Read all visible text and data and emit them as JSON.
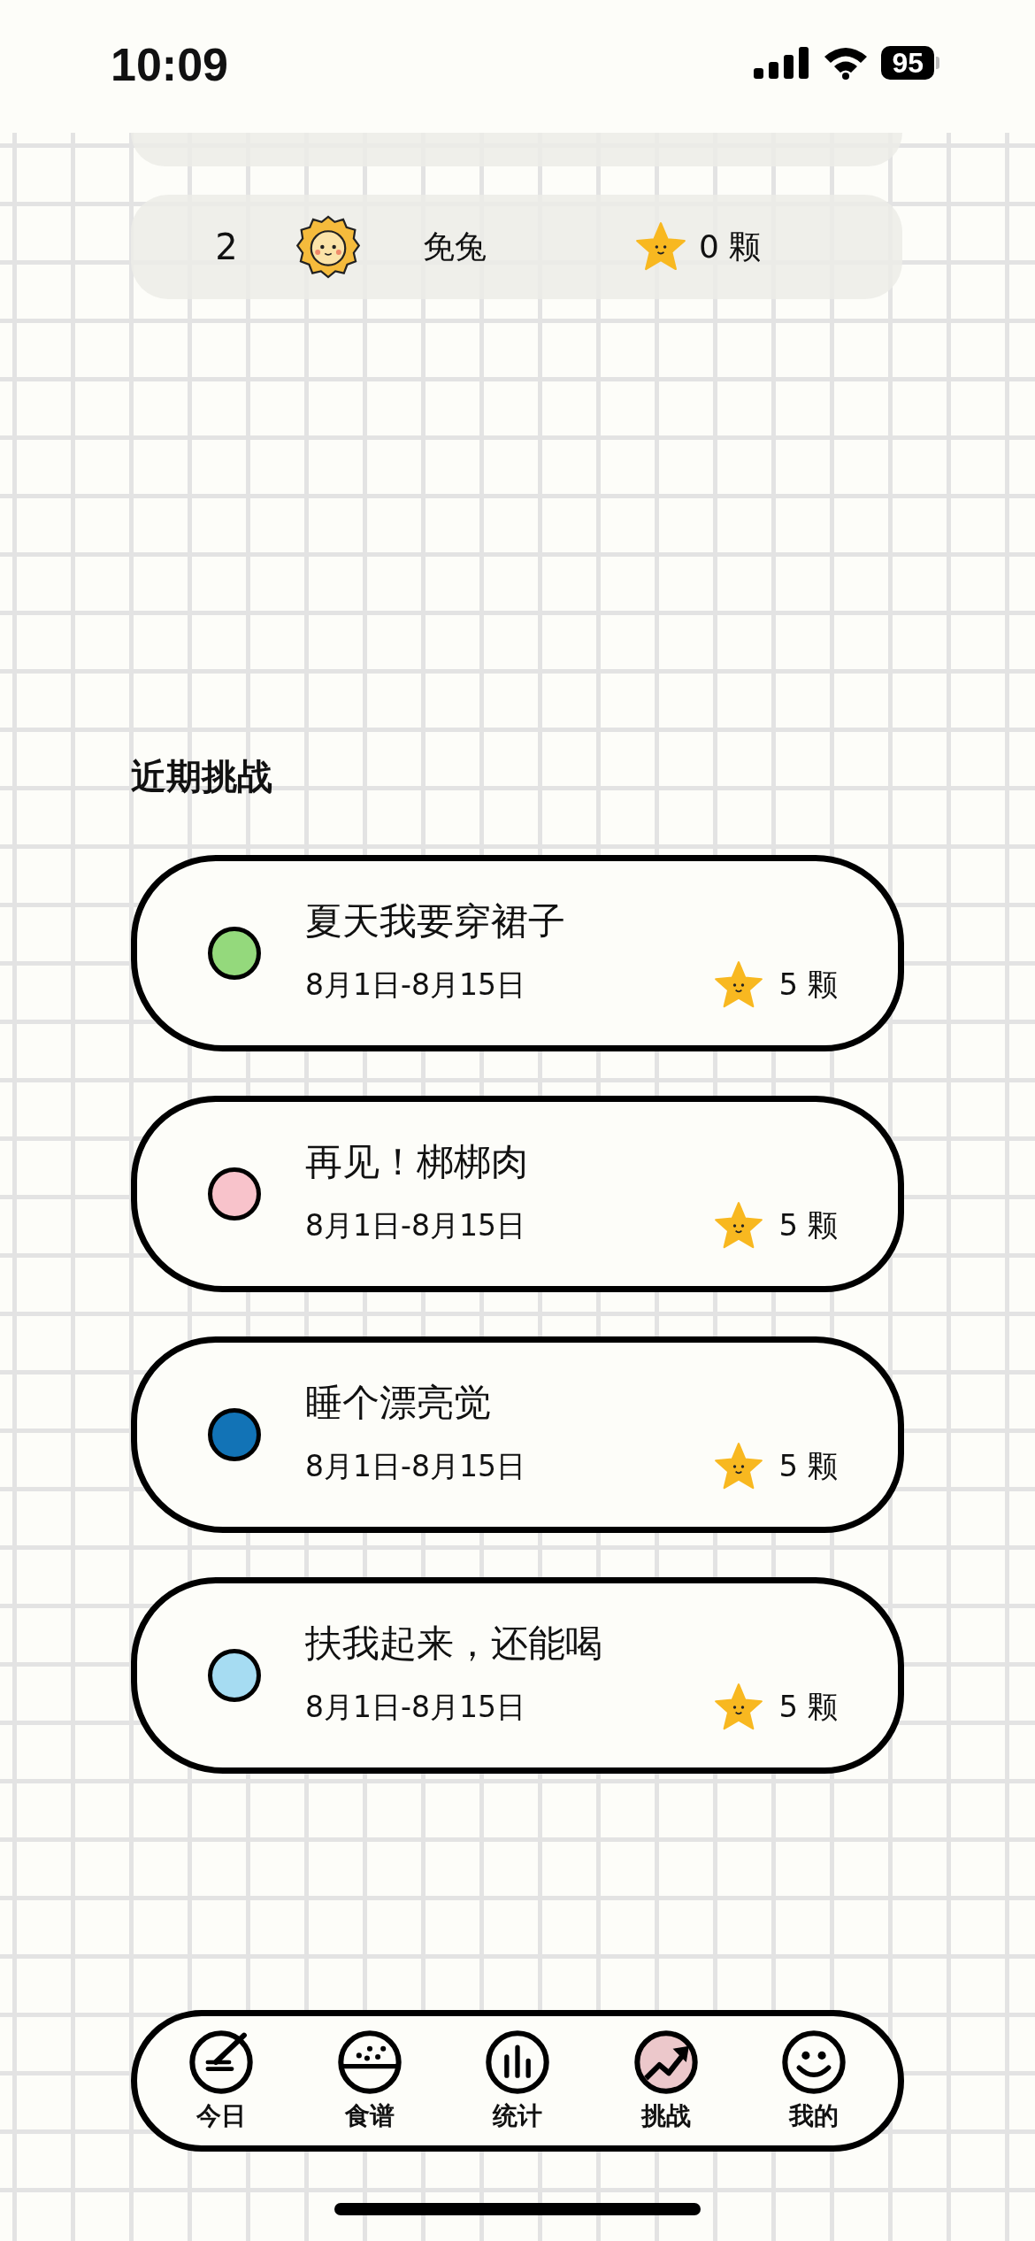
{
  "status_bar": {
    "time": "10:09",
    "battery": "95"
  },
  "ranking": [
    {
      "rank": "2",
      "name": "免兔",
      "stars": "0 颗"
    }
  ],
  "section_title": "近期挑战",
  "challenges": [
    {
      "title": "夏天我要穿裙子",
      "dates": "8月1日-8月15日",
      "reward": "5 颗",
      "color": "#94d97c"
    },
    {
      "title": "再见！梆梆肉",
      "dates": "8月1日-8月15日",
      "reward": "5 颗",
      "color": "#f8c3cb"
    },
    {
      "title": "睡个漂亮觉",
      "dates": "8月1日-8月15日",
      "reward": "5 颗",
      "color": "#1273b6"
    },
    {
      "title": "扶我起来，还能喝",
      "dates": "8月1日-8月15日",
      "reward": "5 颗",
      "color": "#a6dcf2"
    }
  ],
  "tabs": [
    {
      "label": "今日",
      "selected": false
    },
    {
      "label": "食谱",
      "selected": false
    },
    {
      "label": "统计",
      "selected": false
    },
    {
      "label": "挑战",
      "selected": true
    },
    {
      "label": "我的",
      "selected": false
    }
  ]
}
